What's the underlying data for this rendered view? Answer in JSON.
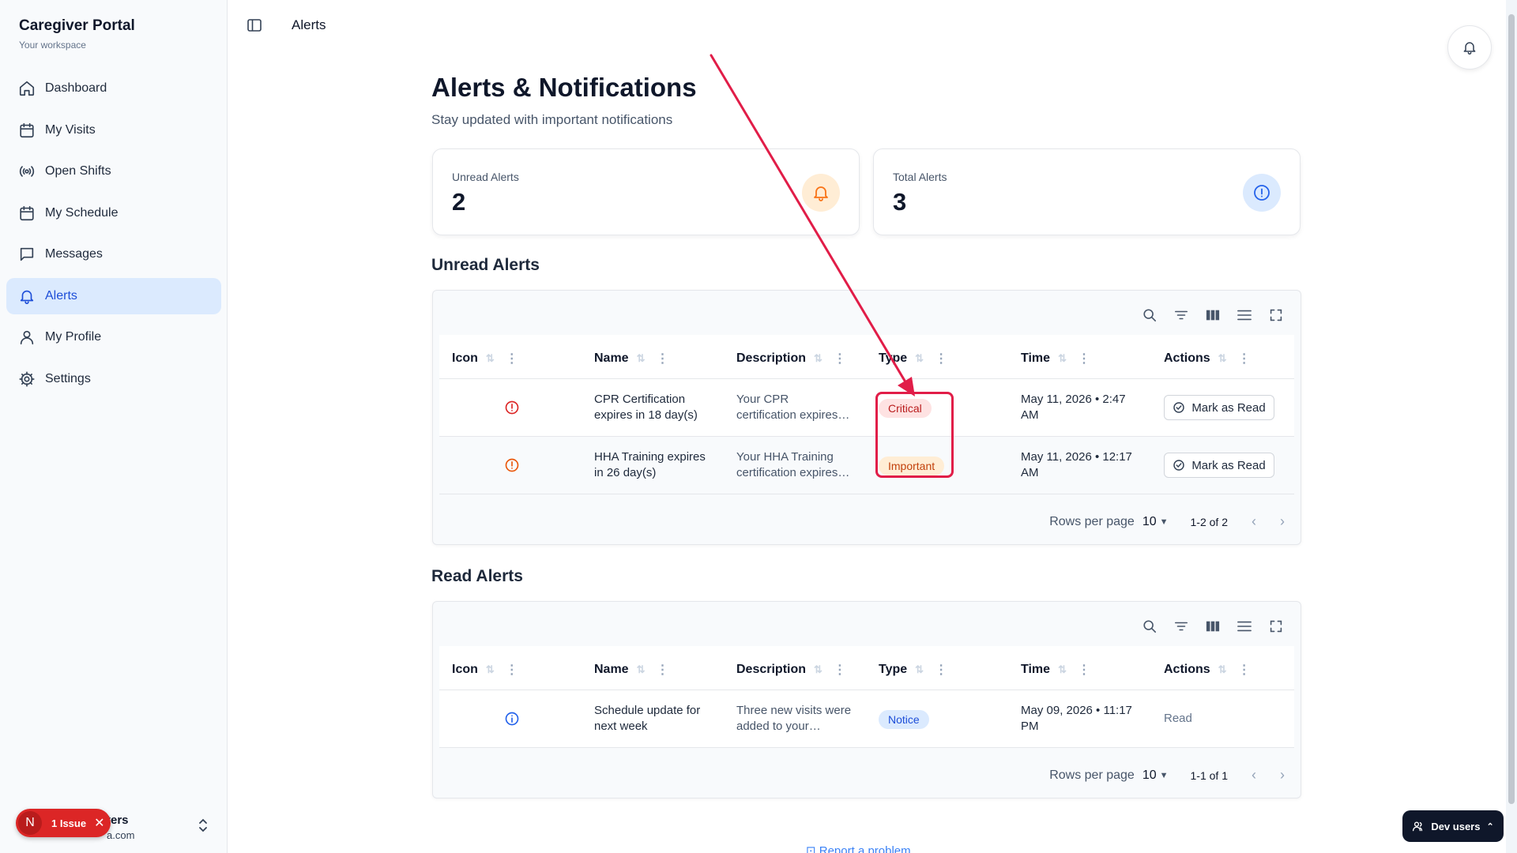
{
  "app": {
    "title": "Caregiver Portal",
    "subtitle": "Your workspace"
  },
  "sidebar": {
    "items": [
      {
        "label": "Dashboard",
        "icon": "home-icon"
      },
      {
        "label": "My Visits",
        "icon": "calendar-icon"
      },
      {
        "label": "Open Shifts",
        "icon": "broadcast-icon"
      },
      {
        "label": "My Schedule",
        "icon": "calendar-icon"
      },
      {
        "label": "Messages",
        "icon": "message-icon"
      },
      {
        "label": "Alerts",
        "icon": "bell-icon",
        "active": true
      },
      {
        "label": "My Profile",
        "icon": "user-icon"
      },
      {
        "label": "Settings",
        "icon": "gear-icon"
      }
    ],
    "user": {
      "name": "ters",
      "email": "a.com"
    },
    "issue_badge": {
      "letter": "N",
      "text": "1 Issue",
      "close": "✕"
    }
  },
  "header": {
    "breadcrumb": "Alerts"
  },
  "page": {
    "title": "Alerts & Notifications",
    "subtitle": "Stay updated with important notifications"
  },
  "stats": {
    "unread": {
      "label": "Unread Alerts",
      "value": "2",
      "color": "#f97316"
    },
    "total": {
      "label": "Total Alerts",
      "value": "3",
      "color": "#2563eb"
    }
  },
  "columns": [
    "Icon",
    "Name",
    "Description",
    "Type",
    "Time",
    "Actions"
  ],
  "unread": {
    "title": "Unread Alerts",
    "rows": [
      {
        "name_1": "CPR Certification",
        "name_2": "expires in 18 day(s)",
        "desc_1": "Your CPR",
        "desc_2": "certification expires…",
        "type": "Critical",
        "time_1": "May 11, 2026 • 2:47",
        "time_2": "AM",
        "action": "Mark as Read"
      },
      {
        "name_1": "HHA Training expires",
        "name_2": "in 26 day(s)",
        "desc_1": "Your HHA Training",
        "desc_2": "certification expires…",
        "type": "Important",
        "time_1": "May 11, 2026 • 12:17",
        "time_2": "AM",
        "action": "Mark as Read"
      }
    ],
    "pager": {
      "rows_label": "Rows per page",
      "rows_value": "10",
      "range": "1-2 of 2"
    }
  },
  "read": {
    "title": "Read Alerts",
    "rows": [
      {
        "name_1": "Schedule update for",
        "name_2": "next week",
        "desc_1": "Three new visits were",
        "desc_2": "added to your…",
        "type": "Notice",
        "time_1": "May 09, 2026 • 11:17",
        "time_2": "PM",
        "action": "Read"
      }
    ],
    "pager": {
      "rows_label": "Rows per page",
      "rows_value": "10",
      "range": "1-1 of 1"
    }
  },
  "footer": {
    "report_link": "Report a problem"
  },
  "dev_users": {
    "label": "Dev users"
  },
  "colors": {
    "accent": "#1d4ed8",
    "annotation": "#e11d48",
    "critical": "#b91c1c",
    "important": "#c2410c",
    "notice": "#1d4ed8"
  }
}
